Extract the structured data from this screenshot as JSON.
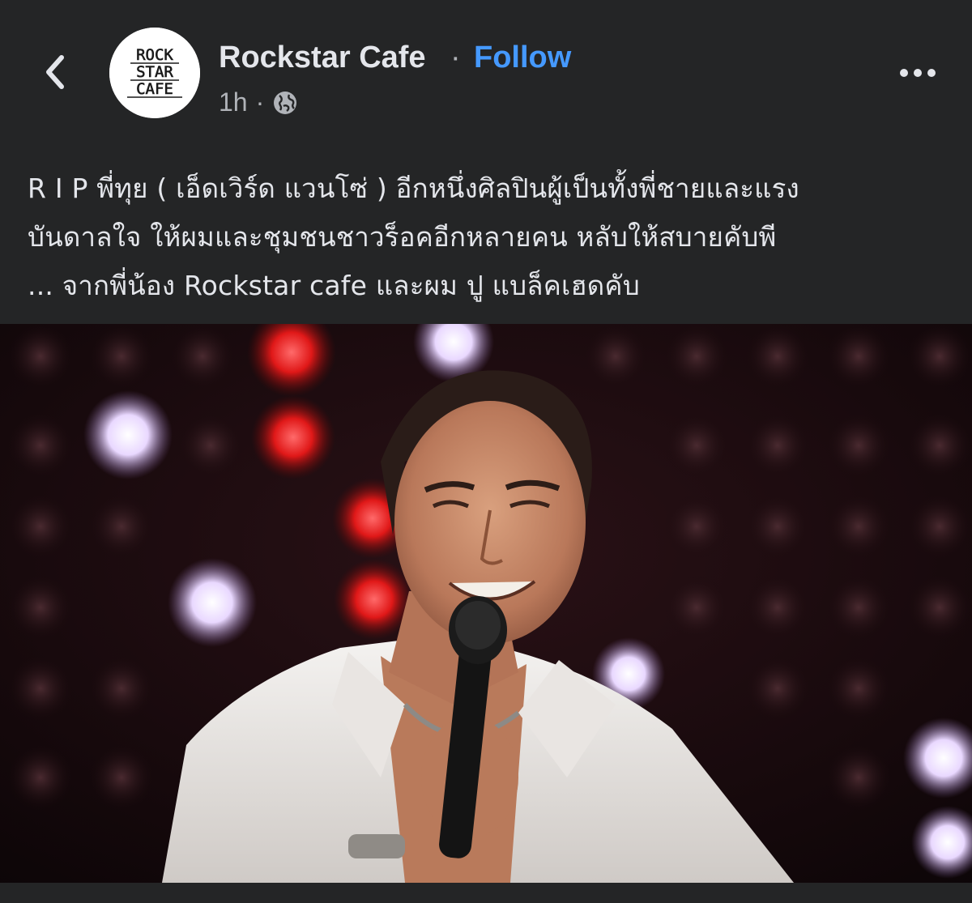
{
  "header": {
    "back_label": "Back",
    "page_name": "Rockstar Cafe",
    "separator": "·",
    "follow_label": "Follow",
    "timestamp": "1h",
    "meta_separator": "·",
    "privacy_icon": "globe-icon",
    "logo_lines": [
      "ROCK",
      "STAR",
      "CAFE"
    ]
  },
  "post": {
    "lines": [
      "R I P พี่ทุย ( เอ็ดเวิร์ด แวนโซ่ ) อีกหนึ่งศิลปินผู้เป็นทั้งพี่ชายและแรง",
      "บันดาลใจ ให้ผมและชุมชนชาวร็อคอีกหลายคน หลับให้สบายคับพี",
      "... จากพี่น้อง Rockstar cafe และผม ปู แบล็คเฮดคับ"
    ]
  },
  "photo": {
    "subject": "singer-with-microphone",
    "bokeh_colors": [
      "#ff3b3b",
      "#f3e6ff",
      "#e0c8ff"
    ]
  },
  "colors": {
    "background": "#242526",
    "text": "#e4e6eb",
    "secondary": "#b0b3b8",
    "accent": "#4599ff"
  }
}
